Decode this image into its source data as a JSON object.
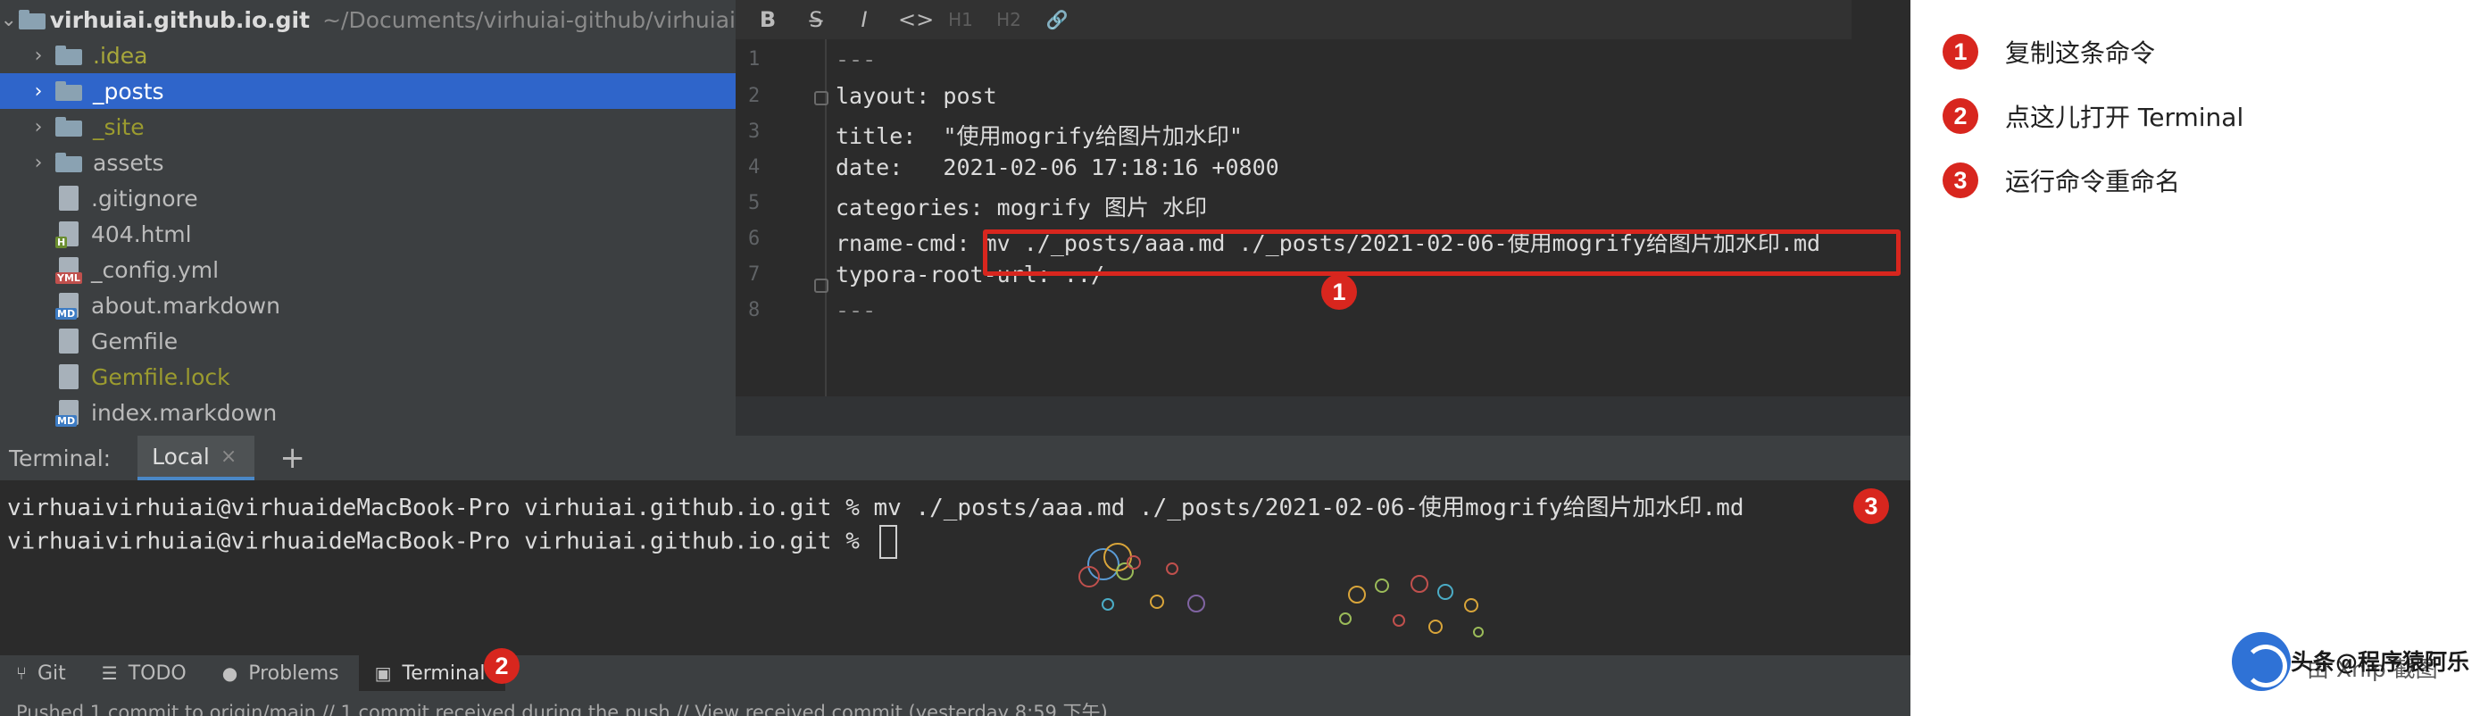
{
  "project_tree": {
    "root_name": "virhuiai.github.io.git",
    "root_path": "~/Documents/virhuiai-github/virhuiai",
    "items": [
      {
        "label": ".idea",
        "kind": "folder"
      },
      {
        "label": "_posts",
        "kind": "folder",
        "selected": true
      },
      {
        "label": "_site",
        "kind": "folder"
      },
      {
        "label": "assets",
        "kind": "folder"
      },
      {
        "label": ".gitignore",
        "kind": "file"
      },
      {
        "label": "404.html",
        "kind": "file",
        "badge": "H"
      },
      {
        "label": "_config.yml",
        "kind": "file",
        "badge": "YML"
      },
      {
        "label": "about.markdown",
        "kind": "file",
        "badge": "MD"
      },
      {
        "label": "Gemfile",
        "kind": "file"
      },
      {
        "label": "Gemfile.lock",
        "kind": "file"
      },
      {
        "label": "index.markdown",
        "kind": "file",
        "badge": "MD"
      }
    ]
  },
  "markdown_toolbar": {
    "bold": "B",
    "strike": "S̶",
    "italic": "I",
    "code": "<>",
    "h1": "H1",
    "h2": "H2",
    "link": "🔗"
  },
  "editor": {
    "lines": [
      {
        "n": "1",
        "text": "---"
      },
      {
        "n": "2",
        "text": "layout: post"
      },
      {
        "n": "3",
        "text": "title:  \"使用mogrify给图片加水印\""
      },
      {
        "n": "4",
        "text": "date:   2021-02-06 17:18:16 +0800"
      },
      {
        "n": "5",
        "text": "categories: mogrify 图片 水印"
      },
      {
        "n": "6",
        "text": "rname-cmd: mv ./_posts/aaa.md ./_posts/2021-02-06-使用mogrify给图片加水印.md"
      },
      {
        "n": "7",
        "text": "typora-root-url: ../"
      },
      {
        "n": "8",
        "text": "---"
      }
    ]
  },
  "terminal": {
    "label": "Terminal:",
    "tab": "Local",
    "close": "×",
    "add": "+",
    "line1": "virhuaivirhuiai@virhuaideMacBook-Pro virhuiai.github.io.git % mv ./_posts/aaa.md ./_posts/2021-02-06-使用mogrify给图片加水印.md",
    "line2": "virhuaivirhuiai@virhuaideMacBook-Pro virhuiai.github.io.git % "
  },
  "tool_windows": [
    {
      "label": "Git",
      "icon": "git-branch-icon"
    },
    {
      "label": "TODO",
      "icon": "list-icon"
    },
    {
      "label": "Problems",
      "icon": "info-icon"
    },
    {
      "label": "Terminal",
      "icon": "terminal-icon",
      "active": true
    }
  ],
  "status_bar": "Pushed 1 commit to origin/main // 1 commit received during the push // View received commit (yesterday 8:59 下午)",
  "annotations": {
    "badges": [
      "1",
      "2",
      "3"
    ],
    "legend": [
      {
        "num": "1",
        "text": "复制这条命令"
      },
      {
        "num": "2",
        "text": "点这儿打开 Terminal"
      },
      {
        "num": "3",
        "text": "运行命令重命名"
      }
    ],
    "accent_color": "#d8261e"
  },
  "watermark": {
    "text": "头条@程序猿阿乐",
    "text2": "由 Xnip 截图"
  }
}
